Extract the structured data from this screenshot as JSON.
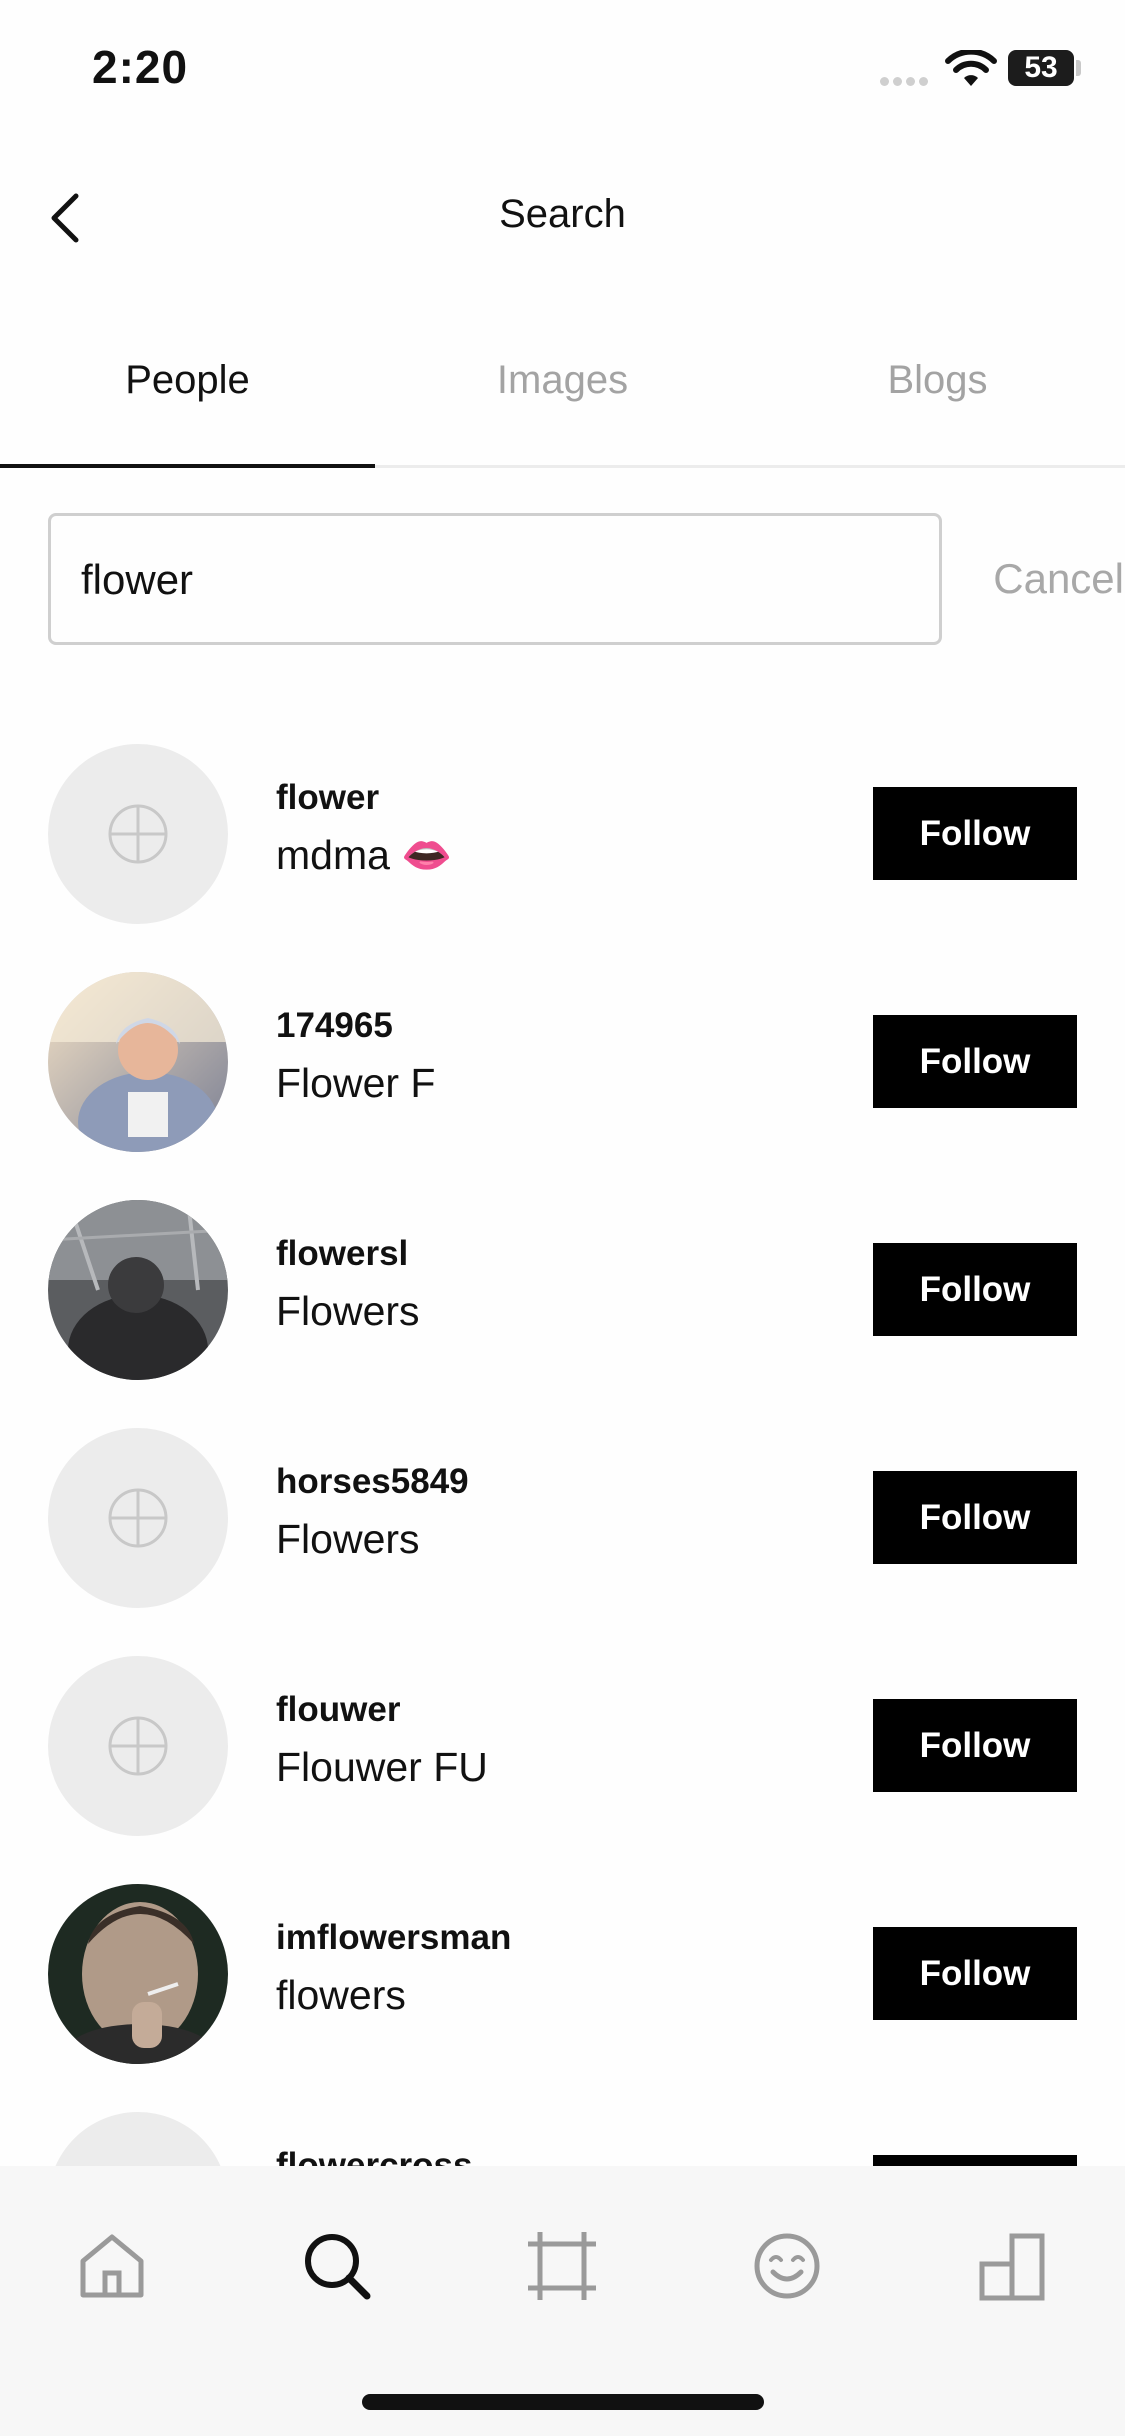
{
  "status_bar": {
    "time": "2:20",
    "battery": "53",
    "icons": [
      "cellular-signal-icon",
      "wifi-icon",
      "battery-icon"
    ]
  },
  "header": {
    "title": "Search",
    "back_icon": "back-chevron-icon"
  },
  "tabs": [
    {
      "label": "People",
      "active": true
    },
    {
      "label": "Images",
      "active": false
    },
    {
      "label": "Blogs",
      "active": false
    }
  ],
  "search": {
    "value": "flower",
    "cancel_label": "Cancel"
  },
  "follow_label": "Follow",
  "results": [
    {
      "username": "flower",
      "display_name": "mdma 👄",
      "avatar": "placeholder"
    },
    {
      "username": "174965",
      "display_name": "Flower F",
      "avatar": "photo"
    },
    {
      "username": "flowersl",
      "display_name": "Flowers",
      "avatar": "photo"
    },
    {
      "username": "horses5849",
      "display_name": "Flowers",
      "avatar": "placeholder"
    },
    {
      "username": "flouwer",
      "display_name": "Flouwer FU",
      "avatar": "placeholder"
    },
    {
      "username": "imflowersman",
      "display_name": "flowers",
      "avatar": "photo"
    },
    {
      "username": "flowercross",
      "display_name": "",
      "avatar": "placeholder"
    }
  ],
  "tabbar": {
    "items": [
      {
        "icon": "home-icon",
        "active": false
      },
      {
        "icon": "search-icon",
        "active": true
      },
      {
        "icon": "crop-frame-icon",
        "active": false
      },
      {
        "icon": "smiley-face-icon",
        "active": false
      },
      {
        "icon": "profile-blocks-icon",
        "active": false
      }
    ]
  },
  "colors": {
    "accent": "#000000",
    "inactive": "#a3a3a3",
    "placeholder_avatar": "#ececec"
  }
}
